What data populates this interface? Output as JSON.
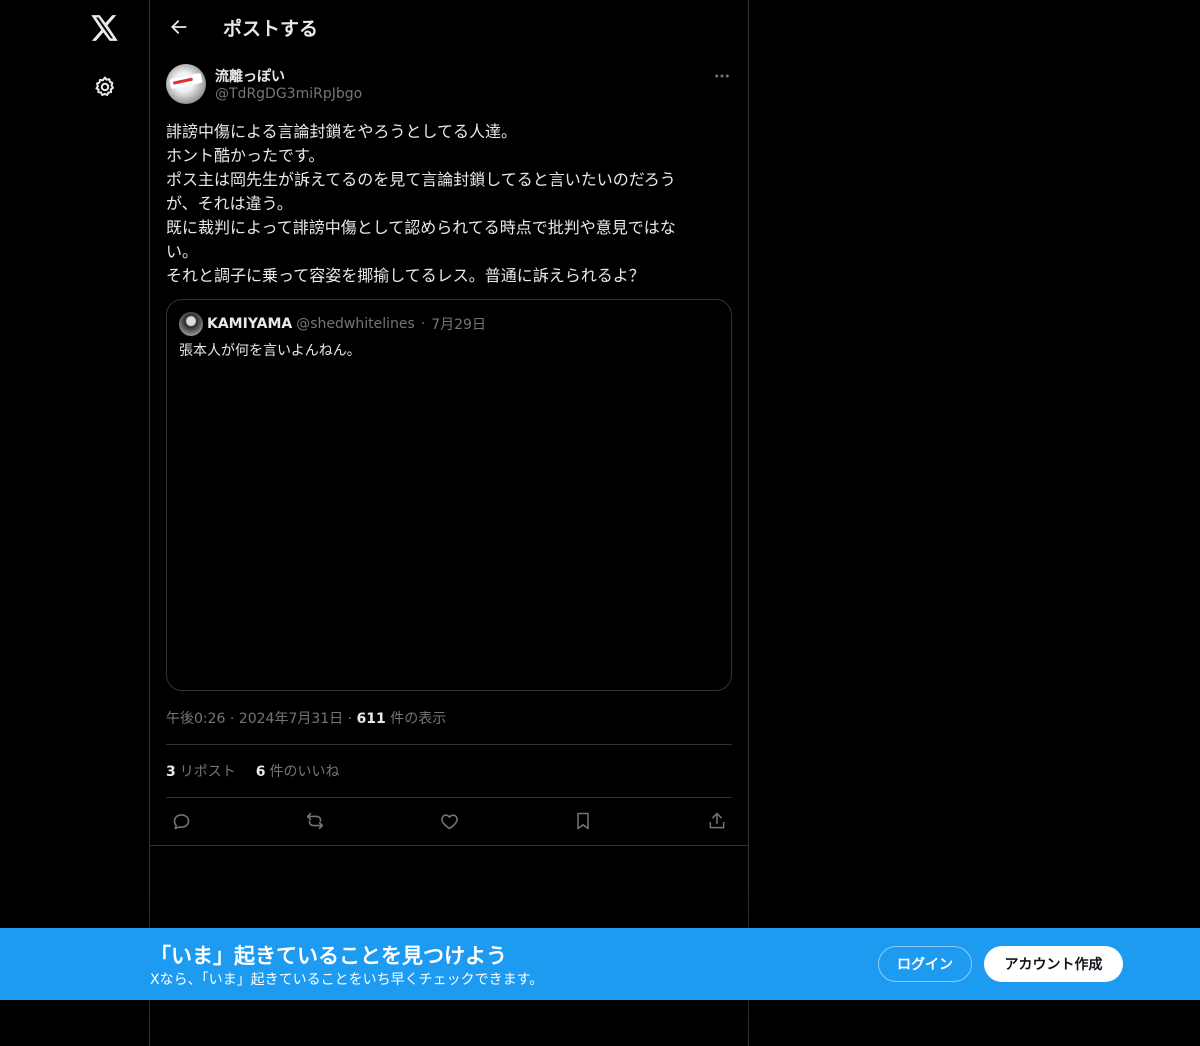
{
  "nav": {
    "logo_icon": "x-logo-icon",
    "settings_icon": "gear-icon"
  },
  "header": {
    "title": "ポストする",
    "back_icon": "arrow-left-icon"
  },
  "post": {
    "author_name": "流離っぽい",
    "author_handle": "@TdRgDG3miRpJbgo",
    "lines": [
      "誹謗中傷による言論封鎖をやろうとしてる人達。",
      "ホント酷かったです。",
      "ポス主は岡先生が訴えてるのを見て言論封鎖してると言いたいのだろう",
      "が、それは違う。",
      "既に裁判によって誹謗中傷として認められてる時点で批判や意見ではな",
      "い。",
      "それと調子に乗って容姿を揶揄してるレス。普通に訴えられるよ？"
    ],
    "time": "午後0:26",
    "date": "2024年7月31日",
    "views_count": "611",
    "views_label": "件の表示",
    "reposts_count": "3",
    "reposts_label": "リポスト",
    "likes_count": "6",
    "likes_label": "件のいいね"
  },
  "quote": {
    "name": "KAMIYAMA",
    "handle": "@shedwhitelines",
    "date": "7月29日",
    "text": "張本人が何を言いよんねん。"
  },
  "banner": {
    "title": "「いま」起きていることを見つけよう",
    "subtitle": "Xなら、「いま」起きていることをいち早くチェックできます。",
    "login_label": "ログイン",
    "signup_label": "アカウント作成"
  },
  "colors": {
    "accent": "#1d9bf0",
    "background": "#000000",
    "text": "#e7e9ea",
    "muted": "#71767b",
    "border": "#2f3336"
  }
}
